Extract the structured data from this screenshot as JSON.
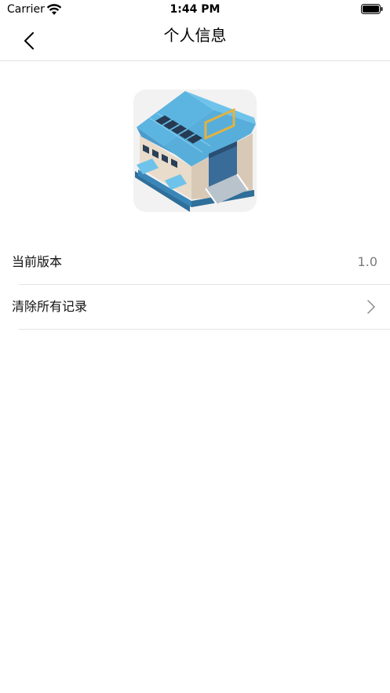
{
  "status_bar": {
    "carrier": "Carrier",
    "time": "1:44 PM"
  },
  "nav": {
    "title": "个人信息"
  },
  "rows": [
    {
      "label": "当前版本",
      "value": "1.0"
    },
    {
      "label": "清除所有记录",
      "value": ""
    }
  ],
  "icons": {
    "back": "chevron-left-icon",
    "wifi": "wifi-icon",
    "battery": "battery-icon",
    "disclosure": "chevron-right-icon",
    "app": "warehouse-building-icon"
  },
  "colors": {
    "roof": "#4aa3d6",
    "wall": "#e8ddd0",
    "divider": "#e3e3e3",
    "secondary_text": "#7a7a7a"
  }
}
